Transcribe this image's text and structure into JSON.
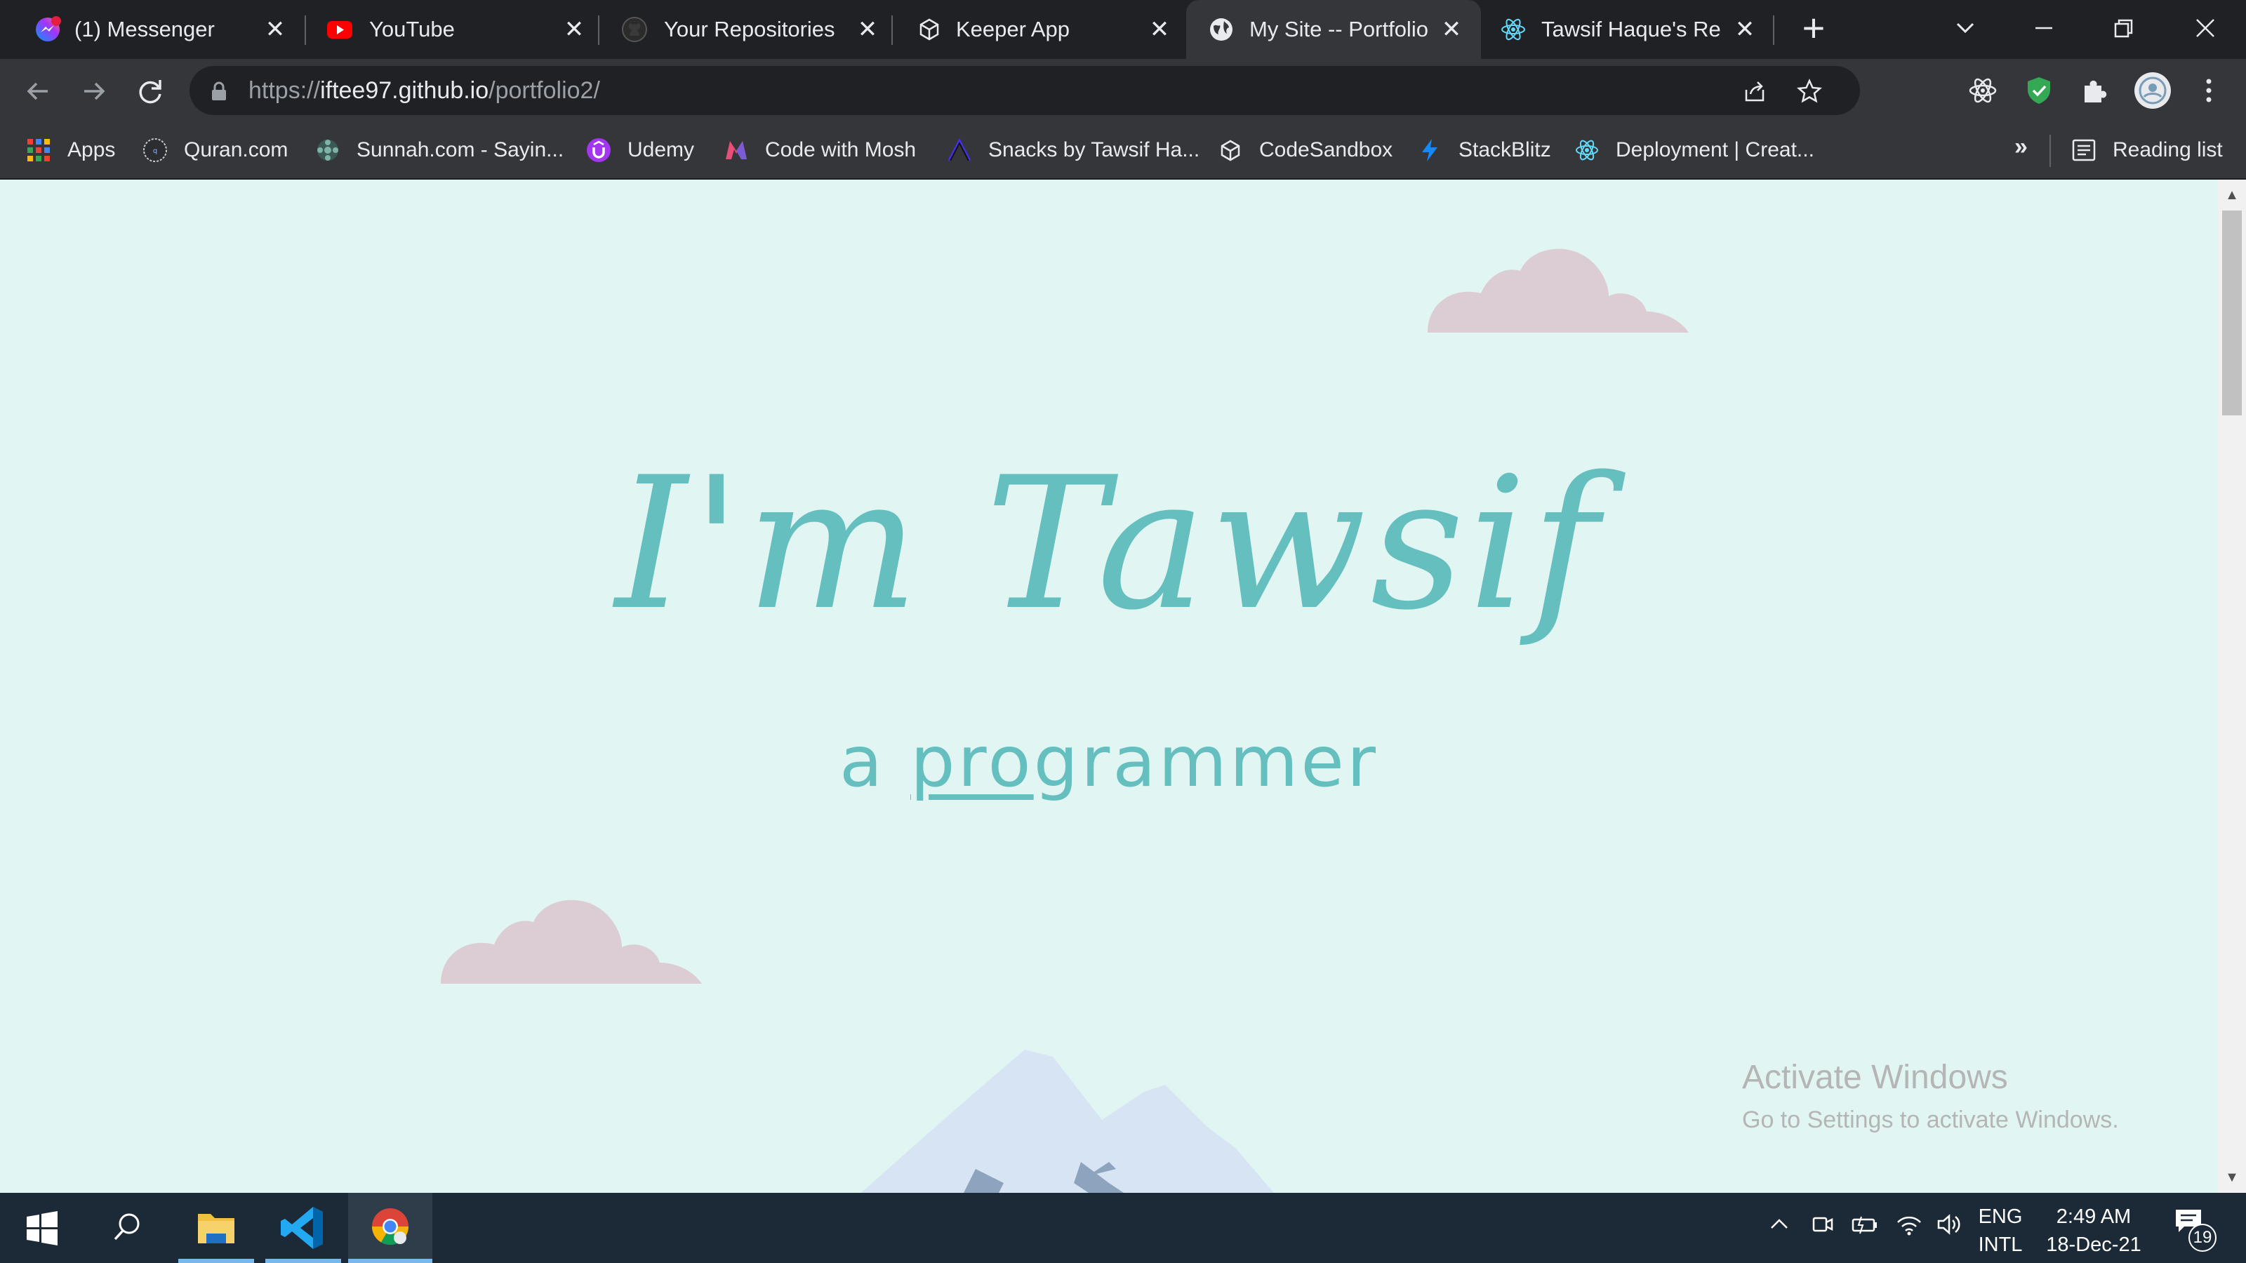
{
  "tabs": [
    {
      "title": "(1) Messenger",
      "icon": "messenger-icon",
      "active": false
    },
    {
      "title": "YouTube",
      "icon": "youtube-icon",
      "active": false
    },
    {
      "title": "Your Repositories",
      "icon": "github-icon",
      "active": false
    },
    {
      "title": "Keeper App",
      "icon": "codesandbox-icon",
      "active": false
    },
    {
      "title": "My Site -- Portfolio",
      "icon": "globe-icon",
      "active": true
    },
    {
      "title": "Tawsif Haque's Resu",
      "icon": "react-icon",
      "active": false
    }
  ],
  "address_bar": {
    "scheme": "https://",
    "host": "iftee97.github.io",
    "path": "/portfolio2/"
  },
  "bookmarks": [
    {
      "label": "Apps",
      "icon": "apps-grid-icon"
    },
    {
      "label": "Quran.com",
      "icon": "quran-icon"
    },
    {
      "label": "Sunnah.com - Sayin...",
      "icon": "sunnah-icon"
    },
    {
      "label": "Udemy",
      "icon": "udemy-icon"
    },
    {
      "label": "Code with Mosh",
      "icon": "mosh-icon"
    },
    {
      "label": "Snacks by Tawsif Ha...",
      "icon": "snack-icon"
    },
    {
      "label": "CodeSandbox",
      "icon": "codesandbox-icon"
    },
    {
      "label": "StackBlitz",
      "icon": "stackblitz-icon"
    },
    {
      "label": "Deployment | Creat...",
      "icon": "react-icon"
    }
  ],
  "bookmarks_more": "»",
  "reading_list": "Reading list",
  "page": {
    "headline": "I'm Tawsif",
    "subline_prefix": "a ",
    "subline_underlined": "pro",
    "subline_rest": "grammer"
  },
  "watermark": {
    "title": "Activate Windows",
    "subtitle": "Go to Settings to activate Windows."
  },
  "taskbar": {
    "language_top": "ENG",
    "language_bottom": "INTL",
    "time": "2:49 AM",
    "date": "18-Dec-21",
    "notification_count": "19"
  },
  "colors": {
    "page_background": "#e1f6f3",
    "headline": "#66bfbf",
    "cloud": "#dbcdd3",
    "mountain": "#d6e4f4"
  }
}
